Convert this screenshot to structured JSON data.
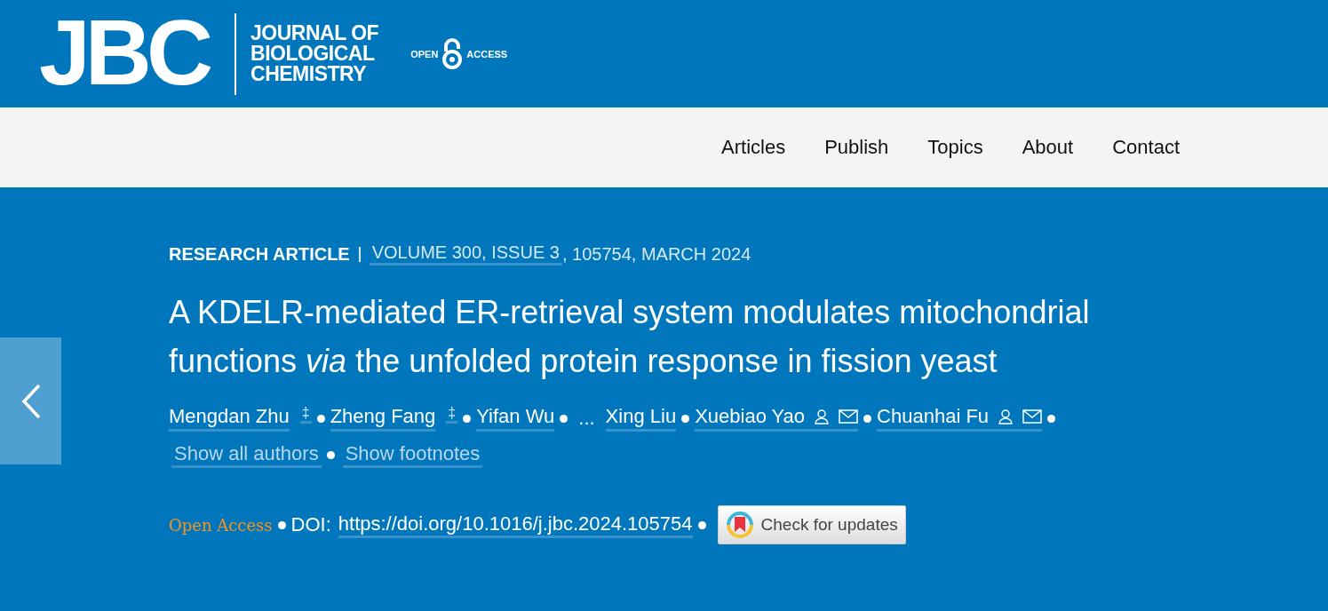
{
  "header": {
    "logo_mark": "JBC",
    "journal_name": [
      "JOURNAL OF",
      "BIOLOGICAL",
      "CHEMISTRY"
    ],
    "open_label": "OPEN",
    "access_label": "ACCESS"
  },
  "nav": [
    "Articles",
    "Publish",
    "Topics",
    "About",
    "Contact"
  ],
  "article": {
    "type": "RESEARCH ARTICLE",
    "issue_link": "VOLUME 300, ISSUE 3",
    "issue_rest": ", 105754, MARCH 2024",
    "title": "A KDELR-mediated ER-retrieval system modulates mitochondrial functions *via* the unfolded protein response in fission yeast",
    "authors": [
      {
        "kind": "author",
        "name": "Mengdan Zhu",
        "footnote": "‡",
        "corresponding": false
      },
      {
        "kind": "author",
        "name": "Zheng Fang",
        "footnote": "‡",
        "corresponding": false
      },
      {
        "kind": "author",
        "name": "Yifan Wu",
        "corresponding": false
      },
      {
        "kind": "ellipsis",
        "text": "..."
      },
      {
        "kind": "author",
        "name": "Xing Liu",
        "corresponding": false
      },
      {
        "kind": "author",
        "name": "Xuebiao Yao",
        "corresponding": true
      },
      {
        "kind": "author",
        "name": "Chuanhai Fu",
        "corresponding": true
      }
    ],
    "author_links": [
      "Show all authors",
      "Show footnotes"
    ],
    "access": "Open Access",
    "doi_label": "DOI:",
    "doi": "https://doi.org/10.1016/j.jbc.2024.105754",
    "updates_button": "Check for updates"
  }
}
